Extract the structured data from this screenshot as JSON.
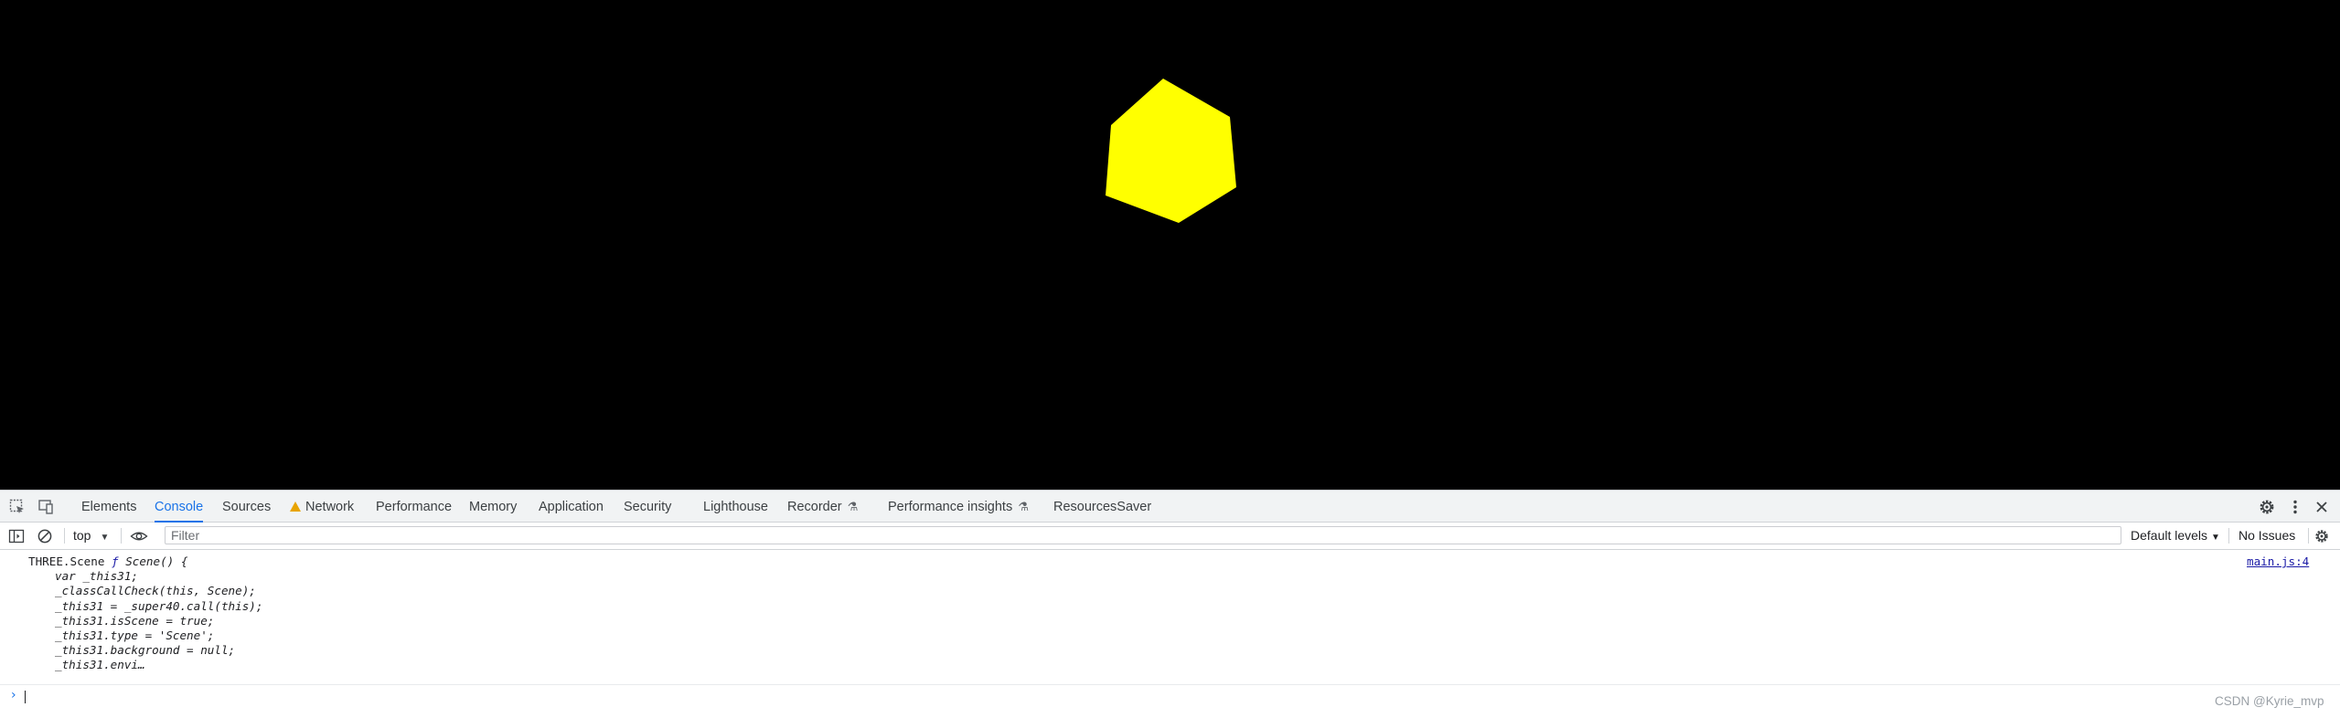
{
  "viewport": {
    "background": "#000000",
    "shape_color": "#ffff00"
  },
  "devtools": {
    "tabs": [
      {
        "label": "Elements",
        "active": false
      },
      {
        "label": "Console",
        "active": true
      },
      {
        "label": "Sources",
        "active": false
      },
      {
        "label": "Network",
        "active": false,
        "warning": true
      },
      {
        "label": "Performance",
        "active": false
      },
      {
        "label": "Memory",
        "active": false
      },
      {
        "label": "Application",
        "active": false
      },
      {
        "label": "Security",
        "active": false
      },
      {
        "label": "Lighthouse",
        "active": false
      },
      {
        "label": "Recorder",
        "active": false,
        "experimental": true
      },
      {
        "label": "Performance insights",
        "active": false,
        "experimental": true
      },
      {
        "label": "ResourcesSaver",
        "active": false
      }
    ],
    "icons": {
      "inspect": "inspect-element-icon",
      "device": "device-toolbar-icon",
      "settings": "gear-icon",
      "more": "more-vertical-icon",
      "close": "close-icon",
      "sidebar": "console-sidebar-icon",
      "clear": "clear-console-icon",
      "eye": "live-expression-eye-icon",
      "console_settings": "gear-icon"
    },
    "accent": "#1a73e8"
  },
  "filterbar": {
    "context": "top",
    "filter_placeholder": "Filter",
    "filter_value": "",
    "levels": "Default levels",
    "issues": "No Issues"
  },
  "console": {
    "entry": {
      "prefix": "THREE.Scene",
      "fn_keyword": "ƒ",
      "signature": "Scene() {",
      "body": [
        "var _this31;",
        "_classCallCheck(this, Scene);",
        "_this31 = _super40.call(this);",
        "_this31.isScene = true;",
        "_this31.type = 'Scene';",
        "_this31.background = null;",
        "_this31.envi…"
      ],
      "source": "main.js:4"
    },
    "prompt": "›"
  },
  "watermark": "CSDN @Kyrie_mvp"
}
